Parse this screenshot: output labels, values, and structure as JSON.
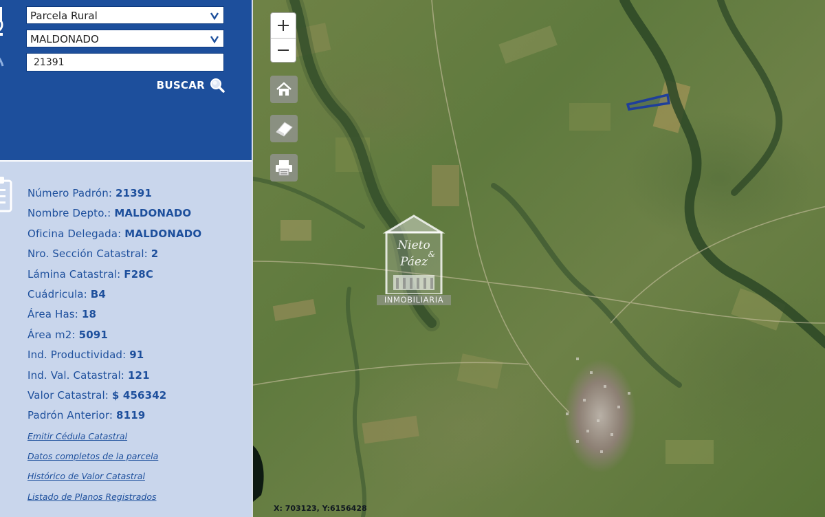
{
  "search": {
    "type_select": "Parcela Rural",
    "dept_select": "MALDONADO",
    "padron_value": "21391",
    "buscar_label": "BUSCAR"
  },
  "info": {
    "rows": [
      {
        "label": "Número Padrón:",
        "value": "21391"
      },
      {
        "label": "Nombre Depto.:",
        "value": "MALDONADO"
      },
      {
        "label": "Oficina Delegada:",
        "value": "MALDONADO"
      },
      {
        "label": "Nro. Sección Catastral:",
        "value": "2"
      },
      {
        "label": "Lámina Catastral:",
        "value": "F28C"
      },
      {
        "label": "Cuádricula:",
        "value": "B4"
      },
      {
        "label": "Área Has:",
        "value": "18"
      },
      {
        "label": "Área m2:",
        "value": "5091"
      },
      {
        "label": "Ind. Productividad:",
        "value": "91"
      },
      {
        "label": "Ind. Val. Catastral:",
        "value": "121"
      },
      {
        "label": "Valor Catastral:",
        "value": "$ 456342"
      },
      {
        "label": "Padrón Anterior:",
        "value": "8119"
      }
    ],
    "links": [
      "Emitir Cédula Catastral",
      "Datos completos de la parcela",
      "Histórico de Valor Catastral",
      "Listado de Planos Registrados"
    ]
  },
  "map": {
    "coords": "X: 703123, Y:6156428",
    "watermark_brand_top": "Nieto",
    "watermark_brand_amp": "&",
    "watermark_brand_bottom": "Páez",
    "watermark_text": "INMOBILIARIA",
    "parcel_color": "#1f3f9a"
  },
  "colors": {
    "panel_blue": "#1d4f9c",
    "info_bg": "#c9d6ec",
    "link_blue": "#1d4f9c"
  }
}
